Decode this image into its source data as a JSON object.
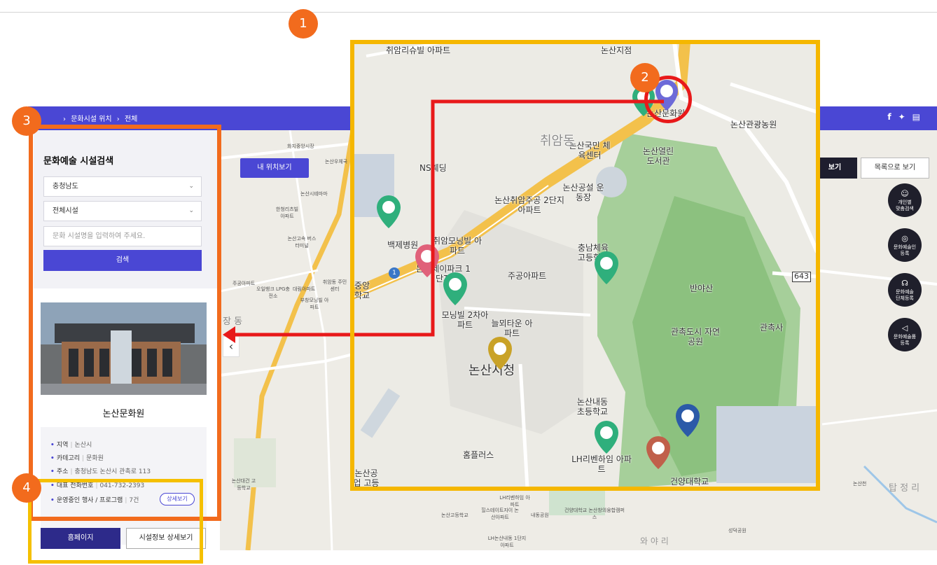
{
  "nav": {
    "breadcrumb": [
      "문화시설 위치",
      "전체"
    ],
    "social_icons": [
      "facebook-icon",
      "twitter-icon",
      "print-icon"
    ]
  },
  "map": {
    "my_location_button": "내 위치보기",
    "view_button": "보기",
    "list_button": "목록으로 보기",
    "quick_buttons": [
      {
        "label": "개인별\n맞춤검색",
        "icon": "heart-search-icon"
      },
      {
        "label": "문화예술인\n등록",
        "icon": "palette-icon"
      },
      {
        "label": "문화예술\n단체등록",
        "icon": "group-icon"
      },
      {
        "label": "문화예술품\n등록",
        "icon": "megaphone-icon"
      }
    ],
    "background_labels": [
      "화지중앙시장",
      "논산우체국",
      "논산시테마마",
      "한청리츠빌 아파트",
      "논산고속 버스터미널",
      "오일뱅크 LPG충전소",
      "대림아파트",
      "취암동 주민센터",
      "부창모닝빌 아파트",
      "주공아파트",
      "논산대건 고등학교",
      "논산고등학교",
      "힐스테이트자이 논산아파트",
      "내동공원",
      "건양대학교 논산창의융합캠퍼스",
      "LH논산내동 1단지아파트",
      "성덕공원",
      "LH리벤하임 아파트",
      "장 동",
      "와 야 리",
      "탑 정 리",
      "논산천"
    ]
  },
  "zoom_map": {
    "labels": [
      "취암리슈빌 아파트",
      "논산지점",
      "논산문화원",
      "논산관광농원",
      "논산국민 체육센터",
      "논산열린 도서관",
      "NS웨딩",
      "논산취암주공 2단지아파트",
      "논산공설 운동장",
      "취암동",
      "백제병원",
      "취암모닝빌 아파트",
      "논산제이파크 1단지",
      "중앙 학교",
      "충남체육 고등학교",
      "주공아파트",
      "반야산",
      "모닝빌 2차아파트",
      "늘뫼타운 아파트",
      "관촉도시 자연공원",
      "관촉사",
      "논산시청",
      "논산내동 초등학교",
      "LH리벤하임 아파트",
      "홈플러스",
      "건양대학교",
      "논산공업 고등",
      "643",
      "1"
    ]
  },
  "panel": {
    "title": "문화예술 시설검색",
    "region_select": "충청남도",
    "facility_select": "전체시설",
    "search_placeholder": "문화 시설명을 입력하여 주세요.",
    "search_button": "검색",
    "facility": {
      "name": "논산문화원",
      "region_label": "지역",
      "region_value": "논산시",
      "category_label": "카테고리",
      "category_value": "문화원",
      "address_label": "주소",
      "address_value": "충청남도 논산시 관촉로 113",
      "phone_label": "대표 전화번호",
      "phone_value": "041-732-2393",
      "events_label": "운영중인 행사 / 프로그램",
      "events_value": "7건",
      "events_detail_button": "상세보기"
    },
    "homepage_button": "홈페이지",
    "detail_button": "시설정보 상세보기"
  },
  "annotations": {
    "markers": [
      "1",
      "2",
      "3",
      "4"
    ]
  },
  "colors": {
    "primary": "#4a47d4",
    "annotation_orange": "#f26b1d",
    "annotation_yellow": "#f5b700",
    "annotation_red": "#e8191a"
  }
}
